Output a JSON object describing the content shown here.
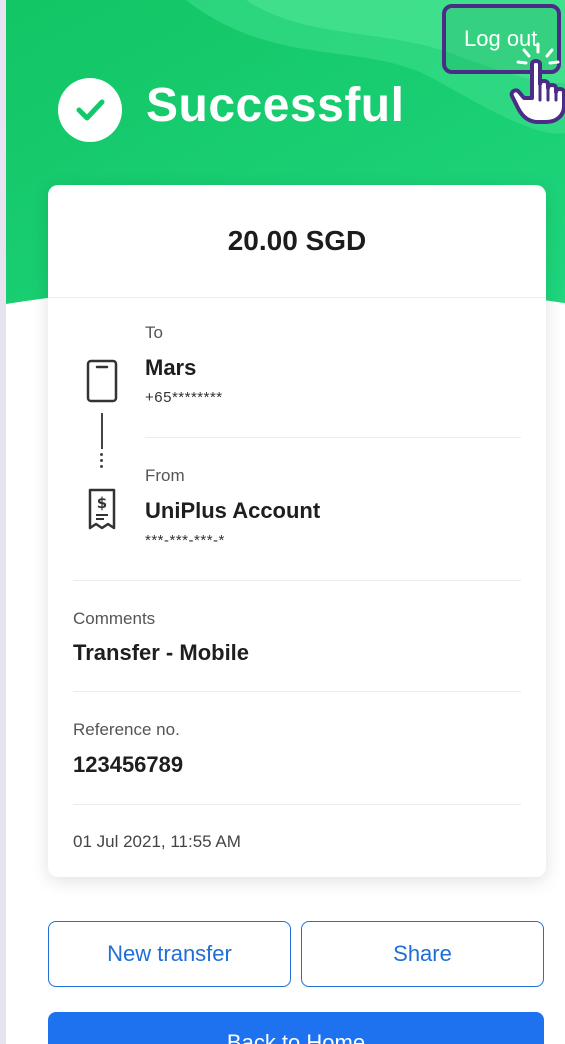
{
  "header": {
    "title": "Successful",
    "logout_label": "Log out"
  },
  "receipt": {
    "amount": "20.00 SGD",
    "to": {
      "label": "To",
      "name": "Mars",
      "number": "+65********"
    },
    "from": {
      "label": "From",
      "name": "UniPlus Account",
      "number": "***-***-***-*"
    },
    "comments": {
      "label": "Comments",
      "value": "Transfer - Mobile"
    },
    "reference": {
      "label": "Reference no.",
      "value": "123456789"
    },
    "datetime": "01 Jul 2021, 11:55 AM"
  },
  "actions": {
    "new_transfer_label": "New transfer",
    "share_label": "Share",
    "back_home_label": "Back to Home"
  },
  "colors": {
    "hero_green": "#13c86a",
    "hero_green_light": "#3ee08d",
    "button_blue": "#1f72ef",
    "outline_blue": "#1f6fd6",
    "highlight_purple": "#4b2d86"
  },
  "icons": {
    "success": "check-circle-icon",
    "cursor": "hand-pointer-icon",
    "recipient": "phone-icon",
    "source": "account-document-icon"
  }
}
